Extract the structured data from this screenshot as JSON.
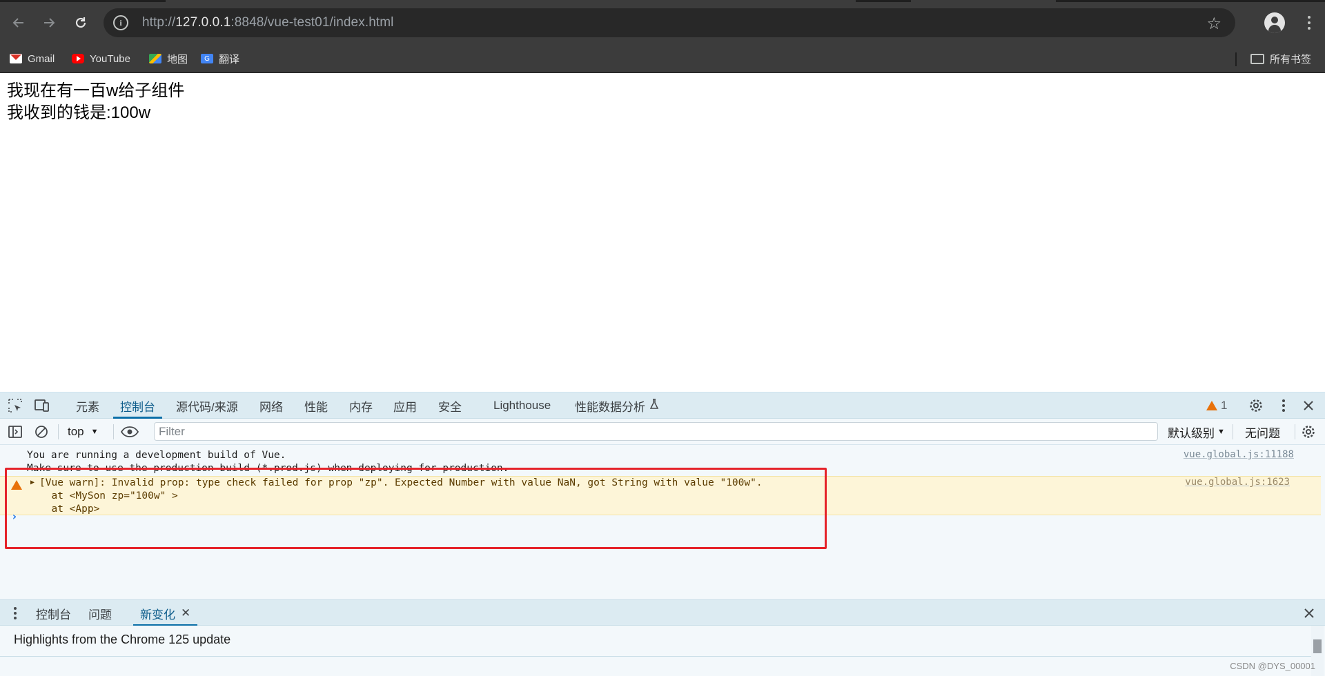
{
  "browser": {
    "url_scheme": "http://",
    "url_host": "127.0.0.1",
    "url_rest": ":8848/vue-test01/index.html",
    "bookmarks": [
      {
        "label": "Gmail",
        "icon": "gmail-icon"
      },
      {
        "label": "YouTube",
        "icon": "youtube-icon"
      },
      {
        "label": "地图",
        "icon": "maps-icon"
      },
      {
        "label": "翻译",
        "icon": "translate-icon"
      }
    ],
    "all_bookmarks_label": "所有书签"
  },
  "page": {
    "line1": "我现在有一百w给子组件",
    "line2": "我收到的钱是:100w"
  },
  "devtools": {
    "tabs": [
      "元素",
      "控制台",
      "源代码/来源",
      "网络",
      "性能",
      "内存",
      "应用",
      "安全",
      "Lighthouse",
      "性能数据分析"
    ],
    "active_tab": "控制台",
    "warning_count": "1",
    "context": "top",
    "filter_placeholder": "Filter",
    "levels": "默认级别",
    "issues": "无问题",
    "console": {
      "info_line1": "You are running a development build of Vue.",
      "info_line2": "Make sure to use the production build (*.prod.js) when deploying for production.",
      "info_source": "vue.global.js:11188",
      "warn_line1": "[Vue warn]: Invalid prop: type check failed for prop \"zp\". Expected Number with value NaN, got String with value \"100w\".",
      "warn_line2": "  at <MySon zp=\"100w\" >",
      "warn_line3": "  at <App>",
      "warn_source": "vue.global.js:1623",
      "prompt": "›"
    },
    "drawer": {
      "tabs": [
        "控制台",
        "问题",
        "新变化"
      ],
      "active_tab": "新变化",
      "content": "Highlights from the Chrome 125 update"
    }
  },
  "watermark": "CSDN @DYS_00001",
  "colors": {
    "chrome_bg": "#3c3c3c",
    "devtools_tabs_bg": "#dcebf2",
    "warning_bg": "#fdf5d8",
    "warning_icon": "#e8710a",
    "annotation_box": "#e5232a"
  }
}
